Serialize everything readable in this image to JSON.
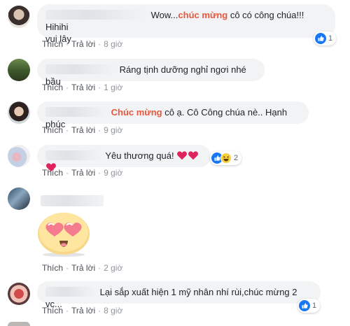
{
  "comments": [
    {
      "pre": "Wow...",
      "highlight": "chúc mừng",
      "post": " cô có công chúa!!! Hihihi",
      "line2": "vui lây",
      "like_label": "Thích",
      "reply_label": "Trả lời",
      "time": "8 giờ",
      "reaction_count": "1"
    },
    {
      "text": "Ráng tịnh dưỡng nghỉ ngơi nhé bầu",
      "like_label": "Thích",
      "reply_label": "Trả lời",
      "time": "1 giờ"
    },
    {
      "highlight": "Chúc mừng",
      "post": " cô ạ. Cô Công chúa nè.. Hạnh phúc",
      "like_label": "Thích",
      "reply_label": "Trả lời",
      "time": "9 giờ"
    },
    {
      "text": "Yêu thương quá!",
      "like_label": "Thích",
      "reply_label": "Trả lời",
      "time": "9 giờ",
      "reaction_count": "2"
    },
    {
      "sticker": "heart-eyes-face",
      "like_label": "Thích",
      "reply_label": "Trả lời",
      "time": "2 giờ"
    },
    {
      "text": "Lại sắp xuất hiện 1 mỹ nhân nhí rùi,chúc mừng 2 vc...",
      "like_label": "Thích",
      "reply_label": "Trả lời",
      "time": "8 giờ",
      "reaction_count": "1"
    }
  ],
  "colors": {
    "bubble": "#f2f3f5",
    "highlight": "#e9573f",
    "like_blue": "#1877f2",
    "heart": "#e0245e"
  }
}
